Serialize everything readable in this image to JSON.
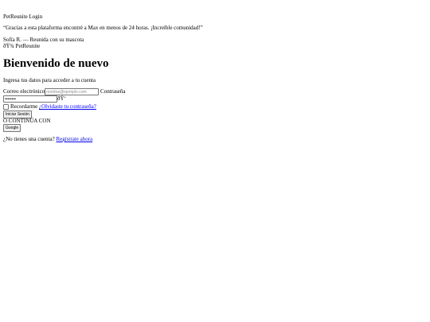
{
  "document": {
    "title": "PetReunite Login"
  },
  "testimonial": {
    "quote": "“Gracias a esta plataforma encontré a Max en menos de 24 horas. ¡Increíble comunidad!”",
    "author": "Sofía R. — Reunida con su mascota",
    "brand": "ðŸ¾ PetReunite"
  },
  "login": {
    "heading": "Bienvenido de nuevo",
    "subtitle": "Ingresa tus datos para acceder a tu cuenta",
    "email_label": "Correo electrónico",
    "email_placeholder": "nombre@ejemplo.com",
    "email_value": "",
    "password_label": "Contraseña",
    "password_value": "••••••••",
    "password_toggle": "ðŸ‘",
    "remember_label": "Recordarme",
    "remember_checked": false,
    "forgot_link": "¿Olvidaste tu contraseña?",
    "submit_label": "Iniciar Sesión",
    "divider_text": "O CONTINÚA CON",
    "google_label": "Google",
    "signup_prompt": "¿No tienes una cuenta?",
    "signup_link": "Regístrate ahora"
  },
  "colors": {
    "background": "#ffffff",
    "text": "#000000",
    "link": "#0000ee"
  }
}
